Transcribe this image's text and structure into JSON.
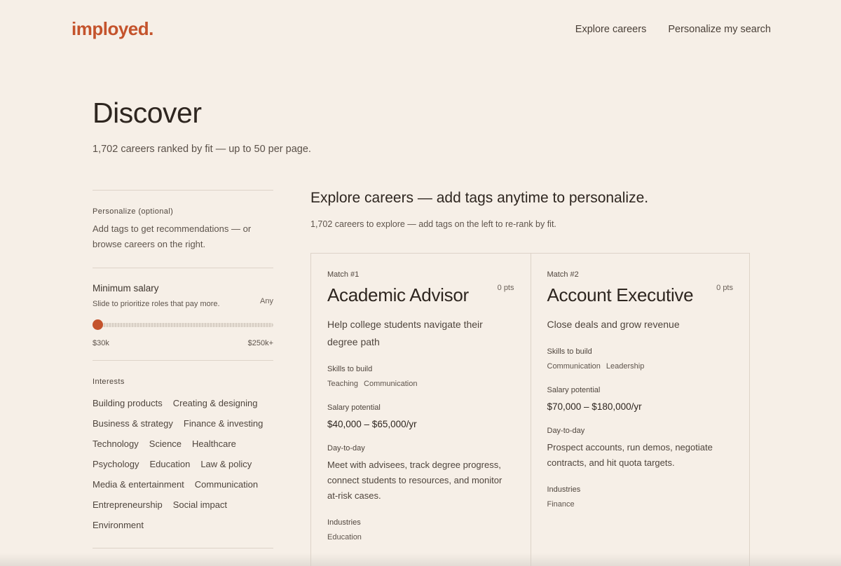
{
  "brand": {
    "logo": "imployed."
  },
  "nav": {
    "explore": "Explore careers",
    "personalize": "Personalize my search"
  },
  "hero": {
    "title": "Discover",
    "subtitle": "1,702 careers ranked by fit — up to 50 per page."
  },
  "sidebar": {
    "personalize_label": "Personalize (optional)",
    "personalize_text": "Add tags to get recommendations — or browse careers on the right.",
    "salary": {
      "title": "Minimum salary",
      "subtitle": "Slide to prioritize roles that pay more.",
      "value_label": "Any",
      "min_label": "$30k",
      "max_label": "$250k+",
      "level": 0
    },
    "interests_label": "Interests",
    "interests": [
      "Building products",
      "Creating & designing",
      "Business & strategy",
      "Finance & investing",
      "Technology",
      "Science",
      "Healthcare",
      "Psychology",
      "Education",
      "Law & policy",
      "Media & entertainment",
      "Communication",
      "Entrepreneurship",
      "Social impact",
      "Environment"
    ]
  },
  "main": {
    "heading": "Explore careers — add tags anytime to personalize.",
    "subheading": "1,702 careers to explore — add tags on the left to re-rank by fit.",
    "labels": {
      "skills": "Skills to build",
      "salary": "Salary potential",
      "day": "Day-to-day",
      "industries": "Industries"
    },
    "cards": [
      {
        "match": "Match #1",
        "pts": "0 pts",
        "title": "Academic Advisor",
        "description": "Help college students navigate their degree path",
        "skills": [
          "Teaching",
          "Communication"
        ],
        "salary": "$40,000 – $65,000/yr",
        "day_to_day": "Meet with advisees, track degree progress, connect students to resources, and monitor at-risk cases.",
        "industries": [
          "Education"
        ]
      },
      {
        "match": "Match #2",
        "pts": "0 pts",
        "title": "Account Executive",
        "description": "Close deals and grow revenue",
        "skills": [
          "Communication",
          "Leadership"
        ],
        "salary": "$70,000 – $180,000/yr",
        "day_to_day": "Prospect accounts, run demos, negotiate contracts, and hit quota targets.",
        "industries": [
          "Finance"
        ]
      }
    ]
  }
}
